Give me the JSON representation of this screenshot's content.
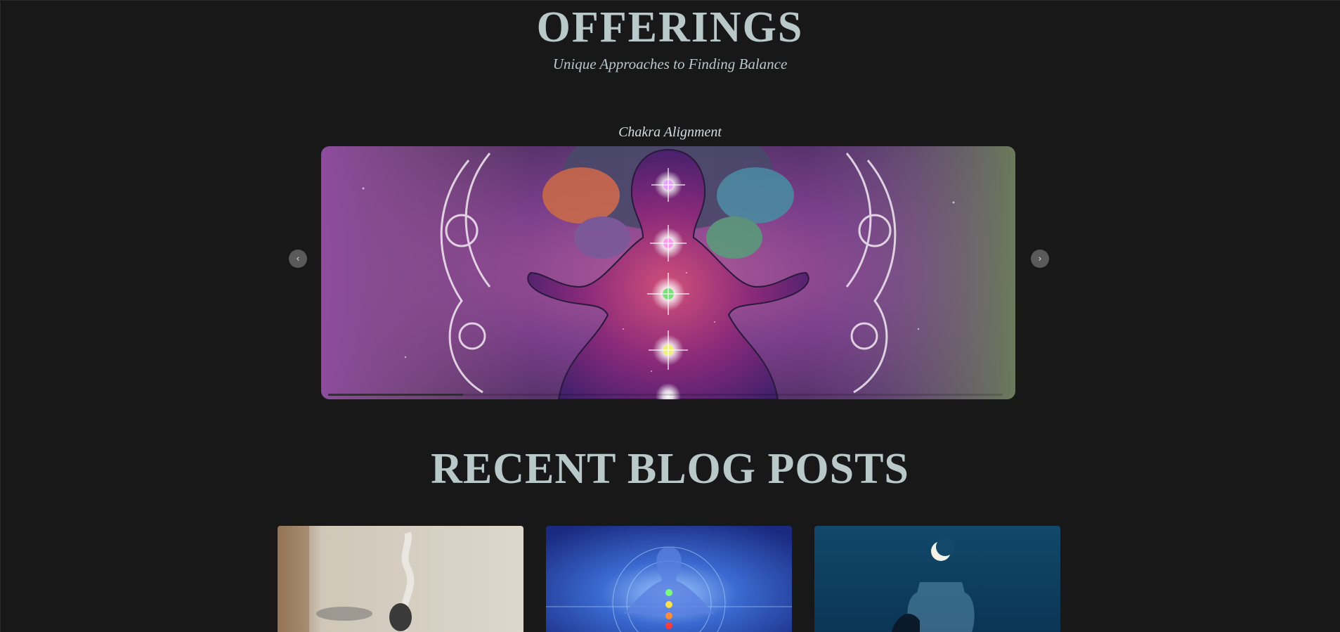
{
  "header": {
    "title": "OFFERINGS",
    "subtitle": "Unique Approaches to Finding Balance"
  },
  "carousel": {
    "slide_caption": "Chakra Alignment",
    "prev_label": "‹",
    "next_label": "›",
    "progress": 0.2,
    "image": "chakra-meditation-figure"
  },
  "blog": {
    "title": "RECENT BLOG POSTS",
    "cards": [
      {
        "image": "smoke-incense-photo"
      },
      {
        "image": "blue-meditation-figure"
      },
      {
        "image": "moon-jar-photo"
      }
    ]
  },
  "colors": {
    "background": "#181818",
    "heading": "#b9c8c9",
    "arrow_bg": "#5a5a5a"
  }
}
